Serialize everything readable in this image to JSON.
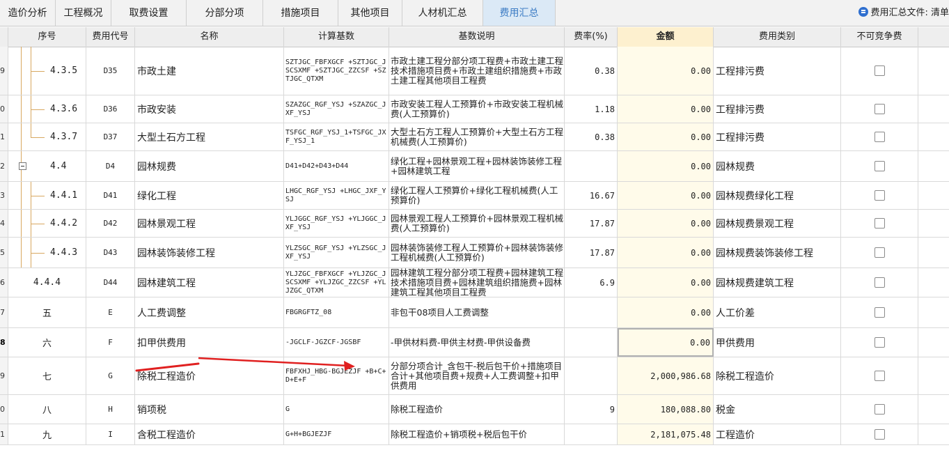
{
  "tabs": [
    {
      "label": "造价分析",
      "active": false
    },
    {
      "label": "工程概况",
      "active": false
    },
    {
      "label": "取费设置",
      "active": false
    },
    {
      "label": "分部分项",
      "active": false
    },
    {
      "label": "措施项目",
      "active": false
    },
    {
      "label": "其他项目",
      "active": false
    },
    {
      "label": "人材机汇总",
      "active": false
    },
    {
      "label": "费用汇总",
      "active": true
    }
  ],
  "file_info": {
    "icon": "info-icon",
    "label": "费用汇总文件: 清单"
  },
  "columns": {
    "seq": "序号",
    "code": "费用代号",
    "name": "名称",
    "calc": "计算基数",
    "desc": "基数说明",
    "rate": "费率(%)",
    "amount": "金额",
    "type": "费用类别",
    "noncomp": "不可竞争费"
  },
  "rows": [
    {
      "rn": "9",
      "seq": "4.3.5",
      "code": "D35",
      "name": "市政土建",
      "calc": "SZTJGC_FBFXGCF +SZTJGC_JSCSXMF +SZTJGC_ZZCSF +SZTJGC_QTXM",
      "desc": "市政土建工程分部分项工程费+市政土建工程技术措施项目费+市政土建组织措施费+市政土建工程其他项目工程费",
      "rate": "0.38",
      "amount": "0.00",
      "type": "工程排污费"
    },
    {
      "rn": "0",
      "seq": "4.3.6",
      "code": "D36",
      "name": "市政安装",
      "calc": "SZAZGC_RGF_YSJ +SZAZGC_JXF_YSJ",
      "desc": "市政安装工程人工预算价+市政安装工程机械费(人工预算价)",
      "rate": "1.18",
      "amount": "0.00",
      "type": "工程排污费"
    },
    {
      "rn": "1",
      "seq": "4.3.7",
      "code": "D37",
      "name": "大型土石方工程",
      "calc": "TSFGC_RGF_YSJ_1+TSFGC_JXF_YSJ_1",
      "desc": "大型土石方工程人工预算价+大型土石方工程机械费(人工预算价)",
      "rate": "0.38",
      "amount": "0.00",
      "type": "工程排污费"
    },
    {
      "rn": "2",
      "seq": "4.4",
      "code": "D4",
      "name": "园林规费",
      "calc": "D41+D42+D43+D44",
      "desc": "绿化工程+园林景观工程+园林装饰装修工程+园林建筑工程",
      "rate": "",
      "amount": "0.00",
      "type": "园林规费"
    },
    {
      "rn": "3",
      "seq": "4.4.1",
      "code": "D41",
      "name": "绿化工程",
      "calc": "LHGC_RGF_YSJ +LHGC_JXF_YSJ",
      "desc": "绿化工程人工预算价+绿化工程机械费(人工预算价)",
      "rate": "16.67",
      "amount": "0.00",
      "type": "园林规费绿化工程"
    },
    {
      "rn": "4",
      "seq": "4.4.2",
      "code": "D42",
      "name": "园林景观工程",
      "calc": "YLJGGC_RGF_YSJ +YLJGGC_JXF_YSJ",
      "desc": "园林景观工程人工预算价+园林景观工程机械费(人工预算价)",
      "rate": "17.87",
      "amount": "0.00",
      "type": "园林规费景观工程"
    },
    {
      "rn": "5",
      "seq": "4.4.3",
      "code": "D43",
      "name": "园林装饰装修工程",
      "calc": "YLZSGC_RGF_YSJ +YLZSGC_JXF_YSJ",
      "desc": "园林装饰装修工程人工预算价+园林装饰装修工程机械费(人工预算价)",
      "rate": "17.87",
      "amount": "0.00",
      "type": "园林规费装饰装修工程"
    },
    {
      "rn": "6",
      "seq": "4.4.4",
      "code": "D44",
      "name": "园林建筑工程",
      "calc": "YLJZGC_FBFXGCF +YLJZGC_JSCSXMF +YLJZGC_ZZCSF +YLJZGC_QTXM",
      "desc": "园林建筑工程分部分项工程费+园林建筑工程技术措施项目费+园林建筑组织措施费+园林建筑工程其他项目工程费",
      "rate": "6.9",
      "amount": "0.00",
      "type": "园林规费建筑工程"
    },
    {
      "rn": "7",
      "seq": "五",
      "code": "E",
      "name": "人工费调整",
      "calc": "FBGRGFTZ_08",
      "desc": "非包干08项目人工费调整",
      "rate": "",
      "amount": "0.00",
      "type": "人工价差"
    },
    {
      "rn": "8",
      "seq": "六",
      "code": "F",
      "name": "扣甲供费用",
      "calc": "-JGCLF-JGZCF-JGSBF",
      "desc": "-甲供材料费-甲供主材费-甲供设备费",
      "rate": "",
      "amount": "0.00",
      "type": "甲供费用"
    },
    {
      "rn": "9",
      "seq": "七",
      "code": "G",
      "name": "除税工程造价",
      "calc": "FBFXHJ_HBG-BGJEZJF +B+C+D+E+F",
      "desc": "分部分项合计_含包干-税后包干价+措施项目合计+其他项目费+规费+人工费调整+扣甲供费用",
      "rate": "",
      "amount": "2,000,986.68",
      "type": "除税工程造价"
    },
    {
      "rn": "0",
      "seq": "八",
      "code": "H",
      "name": "销项税",
      "calc": "G",
      "desc": "除税工程造价",
      "rate": "9",
      "amount": "180,088.80",
      "type": "税金"
    },
    {
      "rn": "1",
      "seq": "九",
      "code": "I",
      "name": "含税工程造价",
      "calc": "G+H+BGJEZJF",
      "desc": "除税工程造价+销项税+税后包干价",
      "rate": "",
      "amount": "2,181,075.48",
      "type": "工程造价"
    }
  ],
  "accent_colors": {
    "active_tab_bg": "#dbe9f6",
    "active_tab_text": "#3c7cc4",
    "amount_header_bg": "#fdf0cf",
    "annotation": "#e02020"
  }
}
